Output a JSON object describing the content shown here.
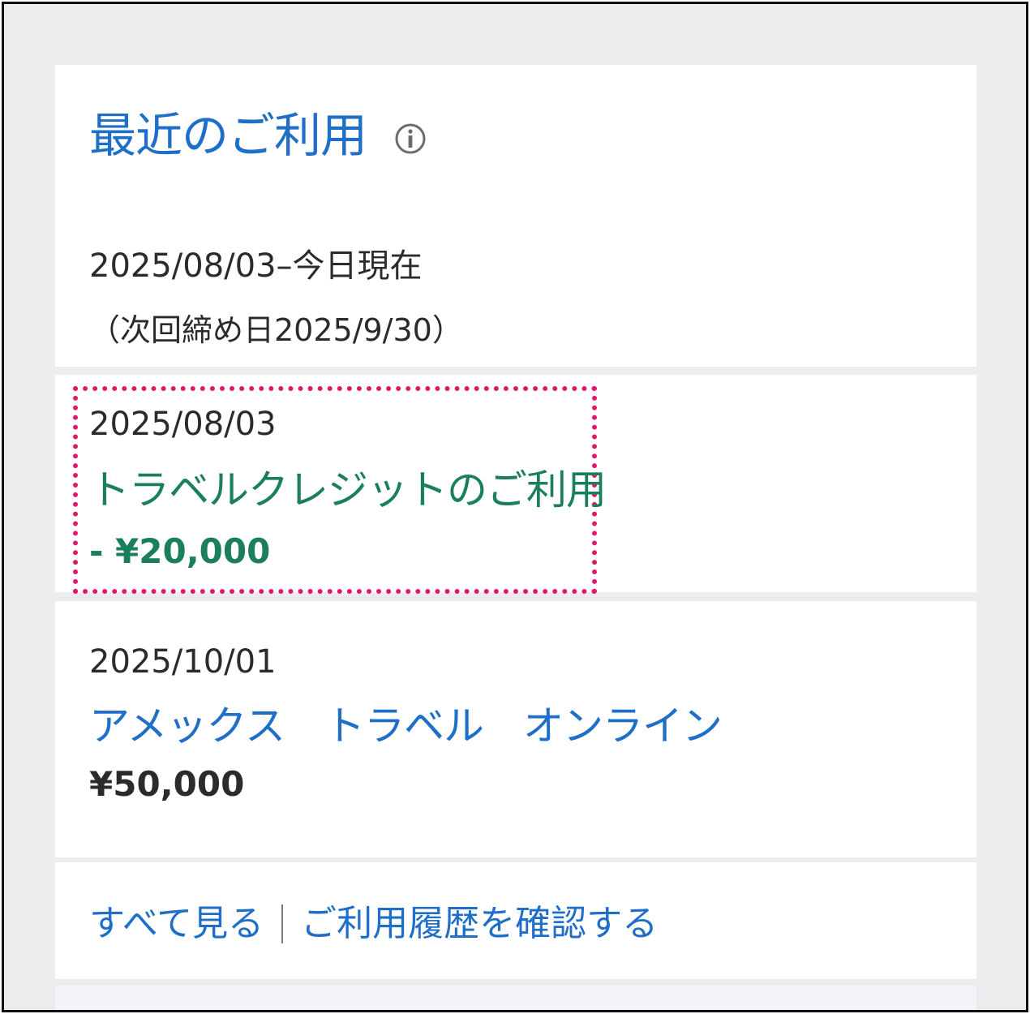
{
  "header": {
    "title": "最近のご利用",
    "info_icon": "info-icon",
    "period": "2025/08/03–今日現在",
    "next_closing": "（次回締め日2025/9/30）"
  },
  "transactions": [
    {
      "date": "2025/08/03",
      "name": "トラベルクレジットのご利用",
      "amount": "-  ¥20,000",
      "highlighted": true,
      "highlight_color": "#e0196b",
      "name_color": "#1a7f5a"
    },
    {
      "date": "2025/10/01",
      "name": "アメックス　トラベル　オンライン",
      "amount": "¥50,000",
      "highlighted": false,
      "name_color": "#1f6fc8"
    }
  ],
  "footer": {
    "view_all": "すべて見る",
    "history_link": "ご利用履歴を確認する"
  },
  "colors": {
    "accent_blue": "#1f6fc8",
    "credit_green": "#1a7f5a",
    "highlight_pink": "#e0196b",
    "background": "#ececee"
  }
}
